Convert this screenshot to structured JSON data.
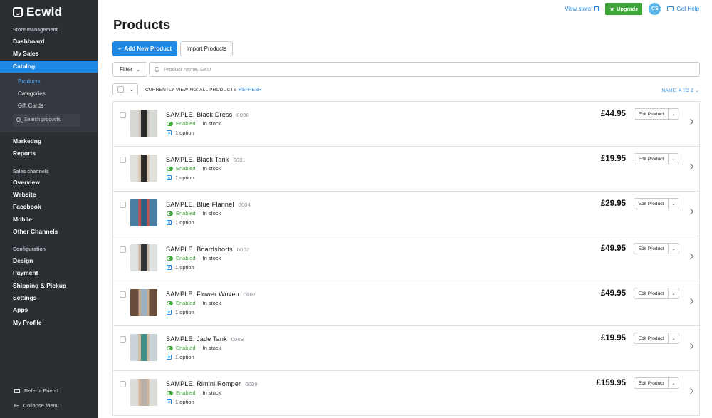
{
  "app": {
    "logo_text": "Ecwid"
  },
  "topbar": {
    "view_store": "View store",
    "upgrade": "Upgrade",
    "avatar_initials": "CS",
    "get_help": "Get Help"
  },
  "sidebar": {
    "sections": {
      "store_management": "Store management",
      "sales_channels": "Sales channels",
      "configuration": "Configuration"
    },
    "store_items": [
      "Dashboard",
      "My Sales",
      "Catalog"
    ],
    "catalog_sub": [
      "Products",
      "Categories",
      "Gift Cards"
    ],
    "search_placeholder": "Search products",
    "more_items": [
      "Marketing",
      "Reports"
    ],
    "channel_items": [
      "Overview",
      "Website",
      "Facebook",
      "Mobile",
      "Other Channels"
    ],
    "config_items": [
      "Design",
      "Payment",
      "Shipping & Pickup",
      "Settings",
      "Apps",
      "My Profile"
    ],
    "refer": "Refer a Friend",
    "collapse": "Collapse Menu"
  },
  "main": {
    "title": "Products",
    "add_button": "Add New Product",
    "import_button": "Import Products",
    "filter": "Filter",
    "search_placeholder": "Product name, SKU",
    "viewing": "CURRENTLY VIEWING: ALL PRODUCTS",
    "refresh": "REFRESH",
    "sort": "NAME: A TO Z",
    "edit_label": "Edit Product"
  },
  "products": [
    {
      "name": "SAMPLE. Black Dress",
      "sku": "0008",
      "status": "Enabled",
      "stock": "In stock",
      "option": "1 option",
      "price": "£44.95",
      "thumb_colors": [
        "#d7d9d4",
        "#2a2a2a",
        "#c8c2b8"
      ]
    },
    {
      "name": "SAMPLE. Black Tank",
      "sku": "0001",
      "status": "Enabled",
      "stock": "In stock",
      "option": "1 option",
      "price": "£19.95",
      "thumb_colors": [
        "#e1e0da",
        "#2d2a29",
        "#d6c4ae"
      ]
    },
    {
      "name": "SAMPLE. Blue Flannel",
      "sku": "0004",
      "status": "Enabled",
      "stock": "In stock",
      "option": "1 option",
      "price": "£29.95",
      "thumb_colors": [
        "#4a7fa3",
        "#2c5e86",
        "#c7514a"
      ]
    },
    {
      "name": "SAMPLE. Boardshorts",
      "sku": "0002",
      "status": "Enabled",
      "stock": "In stock",
      "option": "1 option",
      "price": "£49.95",
      "thumb_colors": [
        "#dfe2e2",
        "#333638",
        "#c8b7a6"
      ]
    },
    {
      "name": "SAMPLE. Flower Woven",
      "sku": "0007",
      "status": "Enabled",
      "stock": "In stock",
      "option": "1 option",
      "price": "£49.95",
      "thumb_colors": [
        "#6a4e3c",
        "#9db0c2",
        "#c8ad91"
      ]
    },
    {
      "name": "SAMPLE. Jade Tank",
      "sku": "0003",
      "status": "Enabled",
      "stock": "In stock",
      "option": "1 option",
      "price": "£19.95",
      "thumb_colors": [
        "#c9d3d8",
        "#3f8f86",
        "#d3b79e"
      ]
    },
    {
      "name": "SAMPLE. Rimini Romper",
      "sku": "0009",
      "status": "Enabled",
      "stock": "In stock",
      "option": "1 option",
      "price": "£159.95",
      "thumb_colors": [
        "#dcdcd8",
        "#b8b0a8",
        "#cfb59c"
      ]
    }
  ],
  "colors": {
    "accent": "#1e88e5",
    "sidebar": "#2b2e33",
    "success": "#3ea538"
  }
}
